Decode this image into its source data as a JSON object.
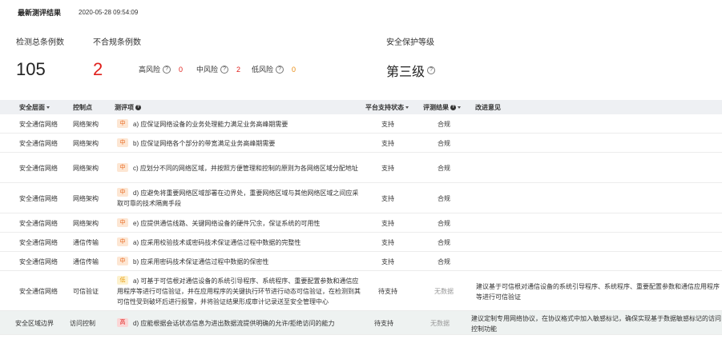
{
  "header": {
    "title": "最新测评结果",
    "time": "2020-05-28 09:54:09"
  },
  "summary": {
    "total_label": "检测总条例数",
    "total_value": "105",
    "noncompliant_label": "不合规条例数",
    "noncompliant_value": "2",
    "high_label": "高风险",
    "high_value": "0",
    "mid_label": "中风险",
    "mid_value": "2",
    "low_label": "低风险",
    "low_value": "0",
    "level_label": "安全保护等级",
    "level_value": "第三级"
  },
  "table": {
    "headers": {
      "layer": "安全层面",
      "control": "控制点",
      "item": "测评项",
      "support": "平台支持状态",
      "result": "评测结果",
      "advice": "改进意见"
    },
    "rows": [
      {
        "layer": "安全通信网络",
        "control": "网络架构",
        "level": "中",
        "item": "a)  应保证网络设备的业务处理能力满足业务高峰期需要",
        "support": "支持",
        "result": "合规",
        "advice": ""
      },
      {
        "layer": "安全通信网络",
        "control": "网络架构",
        "level": "中",
        "item": "b)  应保证网络各个部分的带宽满足业务高峰期需要",
        "support": "支持",
        "result": "合规",
        "advice": ""
      },
      {
        "layer": "安全通信网络",
        "control": "网络架构",
        "level": "中",
        "item": "c)  应划分不同的网络区域，并按照方便管理和控制的原则为各网络区域分配地址",
        "support": "支持",
        "result": "合规",
        "advice": ""
      },
      {
        "layer": "安全通信网络",
        "control": "网络架构",
        "level": "中",
        "item": "d)  应避免将重要网络区域部署在边界处，重要网络区域与其他网络区域之间应采取可靠的技术隔离手段",
        "support": "支持",
        "result": "合规",
        "advice": ""
      },
      {
        "layer": "安全通信网络",
        "control": "网络架构",
        "level": "中",
        "item": "e)  应提供通信线路、关键网络设备的硬件冗余，保证系统的可用性",
        "support": "支持",
        "result": "合规",
        "advice": ""
      },
      {
        "layer": "安全通信网络",
        "control": "通信传输",
        "level": "中",
        "item": "a)  应采用校验技术或密码技术保证通信过程中数据的完整性",
        "support": "支持",
        "result": "合规",
        "advice": ""
      },
      {
        "layer": "安全通信网络",
        "control": "通信传输",
        "level": "中",
        "item": "b)  应采用密码技术保证通信过程中数据的保密性",
        "support": "支持",
        "result": "合规",
        "advice": ""
      },
      {
        "layer": "安全通信网络",
        "control": "可信验证",
        "level": "低",
        "item": "a)  可基于可信根对通信设备的系统引导程序、系统程序、重要配置参数和通信应用程序等进行可信验证，并在应用程序的关键执行环节进行动态可信验证，在检测到其可信性受到破坏后进行报警，并将验证结果形成审计记录送至安全管理中心",
        "support": "待支持",
        "result": "无数据",
        "advice": "建议基于可信根对通信设备的系统引导程序、系统程序、重要配置参数和通信应用程序等进行可信验证"
      },
      {
        "layer": "安全区域边界",
        "control": "访问控制",
        "level": "高",
        "item": "d)  应能根据会话状态信息为进出数据流提供明确的允许/拒绝访问的能力",
        "support": "待支持",
        "result": "无数据",
        "advice": "建议定制专用网络协议，在协议格式中加入敏感标记，确保实现基于数据敏感标记的访问控制功能"
      }
    ]
  }
}
